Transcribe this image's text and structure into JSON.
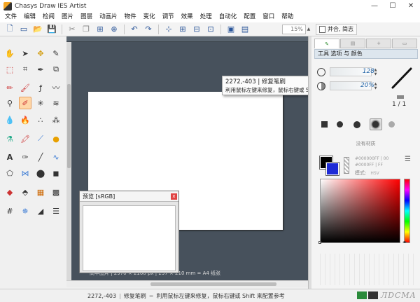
{
  "window": {
    "title": "Chasys Draw IES Artist",
    "controls": [
      "—",
      "☐",
      "✕"
    ]
  },
  "menu": [
    "文件",
    "编辑",
    "检阅",
    "图片",
    "图层",
    "动画片",
    "物件",
    "变化",
    "调节",
    "效果",
    "处理",
    "自动化",
    "配置",
    "窗口",
    "帮助"
  ],
  "toolbar": {
    "zoom_value": "15%",
    "fit_label": "并合, 简志"
  },
  "tooltip": {
    "title": "2272,-403 | 修复笔刷",
    "text": "利用鼠标左键来修复，鼠标右键或 Shift 来配置参考"
  },
  "canvas": {
    "caption": "高中图片 | 2970 × 2100 px | 297 × 210 mm = A4 纸张"
  },
  "preview": {
    "title": "预览 [sRGB]",
    "close": "x"
  },
  "panel": {
    "tabs": [
      "",
      "",
      "+",
      ""
    ],
    "header": "工具 选项 与 颜色",
    "size_value": "128",
    "opacity_value": "20%",
    "ratio": "1 / 1",
    "no_texture": "没有材质",
    "hex_fg": "#000000FF | 00",
    "hex_bg": "#0000FF | FF",
    "mode_label": "模式:",
    "mode_value": "HSV"
  },
  "status": {
    "coords": "2272,-403",
    "tool": "修复笔刷",
    "hint": "利用鼠标左键来修复，鼠标右键或 Shift 来配置参考"
  },
  "watermark": {
    "text": "ЛDCMA"
  },
  "colors": {
    "accent": "#2a5599",
    "canvas_bg": "#47515c",
    "fg": "#000000",
    "bg": "#1e2bd6"
  }
}
